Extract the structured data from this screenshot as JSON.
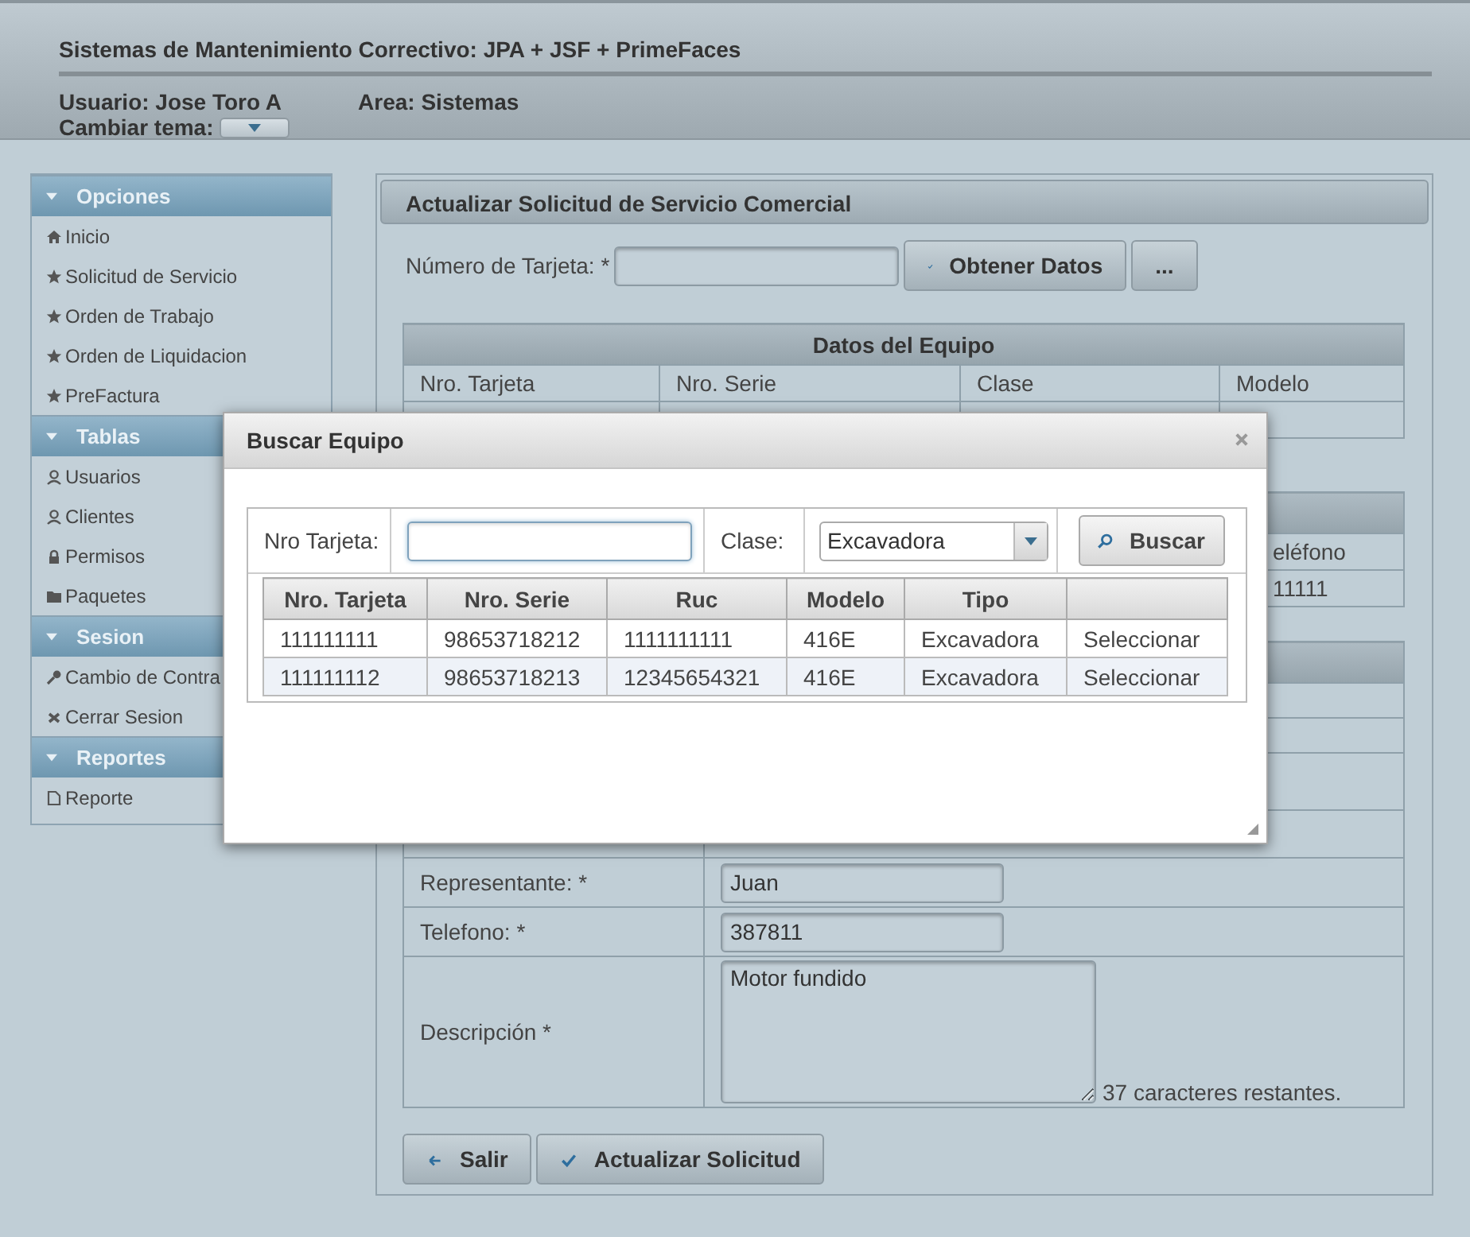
{
  "header": {
    "title": "Sistemas de Mantenimiento Correctivo: JPA + JSF + PrimeFaces",
    "user": "Usuario: Jose Toro A",
    "area": "Area: Sistemas",
    "theme_label": "Cambiar tema:"
  },
  "sidebar": [
    {
      "title": "Opciones",
      "expanded": true,
      "items": [
        {
          "label": "Inicio"
        },
        {
          "label": "Solicitud de Servicio"
        },
        {
          "label": "Orden de Trabajo"
        },
        {
          "label": "Orden de Liquidacion"
        },
        {
          "label": "PreFactura"
        }
      ]
    },
    {
      "title": "Tablas",
      "expanded": true,
      "items": [
        {
          "label": "Usuarios"
        },
        {
          "label": "Clientes"
        },
        {
          "label": "Permisos"
        },
        {
          "label": "Paquetes"
        }
      ]
    },
    {
      "title": "Sesion",
      "expanded": true,
      "items": [
        {
          "label": "Cambio de Contra"
        },
        {
          "label": "Cerrar Sesion"
        }
      ]
    },
    {
      "title": "Reportes",
      "expanded": true,
      "items": [
        {
          "label": "Reporte"
        }
      ]
    }
  ],
  "main": {
    "title": "Actualizar Solicitud de Servicio Comercial",
    "card_label": "Número de Tarjeta: *",
    "buttons": [
      {
        "label": "Obtener Datos"
      },
      {
        "label": "..."
      }
    ]
  },
  "equipment": {
    "title": "Datos del Equipo",
    "columns": [
      "Nro. Tarjeta",
      "Nro. Serie",
      "Clase",
      "Modelo"
    ]
  },
  "client": {
    "column_5": "eléfono",
    "cell_5": "11111"
  },
  "form": [
    {
      "kind": "input",
      "label": "Representante: *",
      "value": "Juan"
    },
    {
      "kind": "input",
      "label": "Telefono: *",
      "value": "387811"
    },
    {
      "kind": "textarea",
      "label": "Descripción *",
      "value": "Motor fundido",
      "counter": "37 caracteres restantes."
    }
  ],
  "actions": [
    {
      "label": "Salir"
    },
    {
      "label": "Actualizar Solicitud"
    }
  ],
  "dialog": {
    "title": "Buscar Equipo",
    "card_label": "Nro Tarjeta:",
    "class_label": "Clase:",
    "class_value": "Excavadora",
    "search_button": "Buscar",
    "columns": [
      "Nro. Tarjeta",
      "Nro. Serie",
      "Ruc",
      "Modelo",
      "Tipo"
    ],
    "rows": [
      {
        "selected": false,
        "cells": [
          "111111111",
          "98653718212",
          "1111111111",
          "416E",
          "Excavadora"
        ],
        "action": "Seleccionar"
      },
      {
        "selected": true,
        "cells": [
          "111111112",
          "98653718213",
          "12345654321",
          "416E",
          "Excavadora"
        ],
        "action": "Seleccionar"
      }
    ]
  }
}
